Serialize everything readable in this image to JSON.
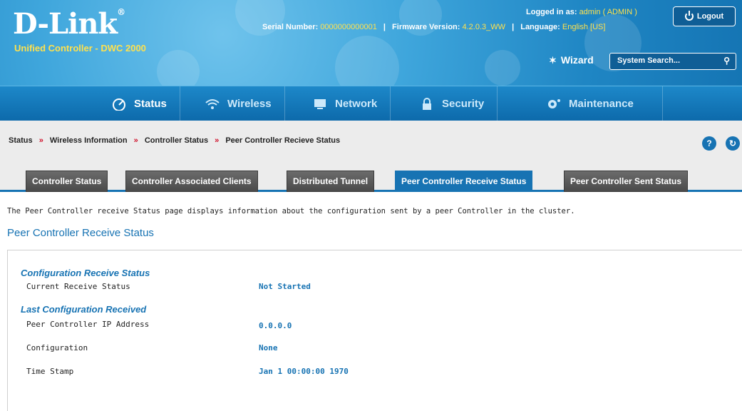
{
  "header": {
    "logo": "D-Link",
    "logo_mark": "®",
    "subtitle": "Unified Controller - DWC 2000",
    "logged_in_label": "Logged in as:",
    "logged_in_user": "admin ( ADMIN )",
    "logout_label": "Logout",
    "serial_label": "Serial Number:",
    "serial_value": "0000000000001",
    "firmware_label": "Firmware Version:",
    "firmware_value": "4.2.0.3_WW",
    "language_label": "Language:",
    "language_value": "English [US]",
    "wizard_label": "Wizard",
    "search_placeholder": "System Search..."
  },
  "nav": {
    "items": [
      {
        "label": "Status",
        "icon": "gauge-icon"
      },
      {
        "label": "Wireless",
        "icon": "wifi-icon"
      },
      {
        "label": "Network",
        "icon": "monitor-icon"
      },
      {
        "label": "Security",
        "icon": "lock-icon"
      },
      {
        "label": "Maintenance",
        "icon": "gear-icon"
      }
    ]
  },
  "breadcrumb": {
    "items": [
      "Status",
      "Wireless Information",
      "Controller Status",
      "Peer Controller Recieve Status"
    ],
    "separator": "»"
  },
  "tabs": [
    {
      "label": "Controller Status",
      "active": false
    },
    {
      "label": "Controller Associated Clients",
      "active": false
    },
    {
      "label": "Distributed Tunnel",
      "active": false
    },
    {
      "label": "Peer Controller Receive Status",
      "active": true
    },
    {
      "label": "Peer Controller Sent Status",
      "active": false
    }
  ],
  "content": {
    "description": "The Peer Controller receive Status page displays information about the configuration sent by a peer Controller in the cluster.",
    "page_title": "Peer Controller Receive Status",
    "sections": [
      {
        "title": "Configuration Receive Status",
        "fields": [
          {
            "label": "Current Receive Status",
            "value": "Not Started"
          }
        ]
      },
      {
        "title": "Last Configuration Received",
        "fields": [
          {
            "label": "Peer Controller IP Address",
            "value": "0.0.0.0"
          },
          {
            "label": "Configuration",
            "value": "None"
          },
          {
            "label": "Time Stamp",
            "value": "Jan 1 00:00:00 1970"
          }
        ]
      }
    ]
  },
  "colors": {
    "accent": "#1773b3",
    "highlight": "#ffe14d",
    "breadcrumb_arrow": "#d0102a"
  }
}
